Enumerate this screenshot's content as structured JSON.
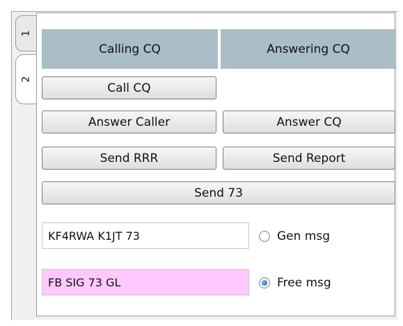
{
  "tabs": [
    {
      "label": "1",
      "selected": false
    },
    {
      "label": "2",
      "selected": true
    }
  ],
  "header": {
    "calling": "Calling CQ",
    "answering": "Answering CQ"
  },
  "buttons": {
    "call_cq": "Call CQ",
    "answer_caller": "Answer Caller",
    "answer_cq": "Answer CQ",
    "send_rrr": "Send RRR",
    "send_report": "Send Report",
    "send_73": "Send 73"
  },
  "messages": {
    "gen_value": "KF4RWA K1JT 73",
    "gen_label": "Gen msg",
    "gen_selected": false,
    "free_value": "FB SIG 73 GL",
    "free_label": "Free msg",
    "free_selected": true
  },
  "colors": {
    "header_bg": "#a9bec7",
    "free_field_bg": "#ffc8ff",
    "panel_bg": "#ffffff",
    "window_bg": "#f0f0f0"
  }
}
